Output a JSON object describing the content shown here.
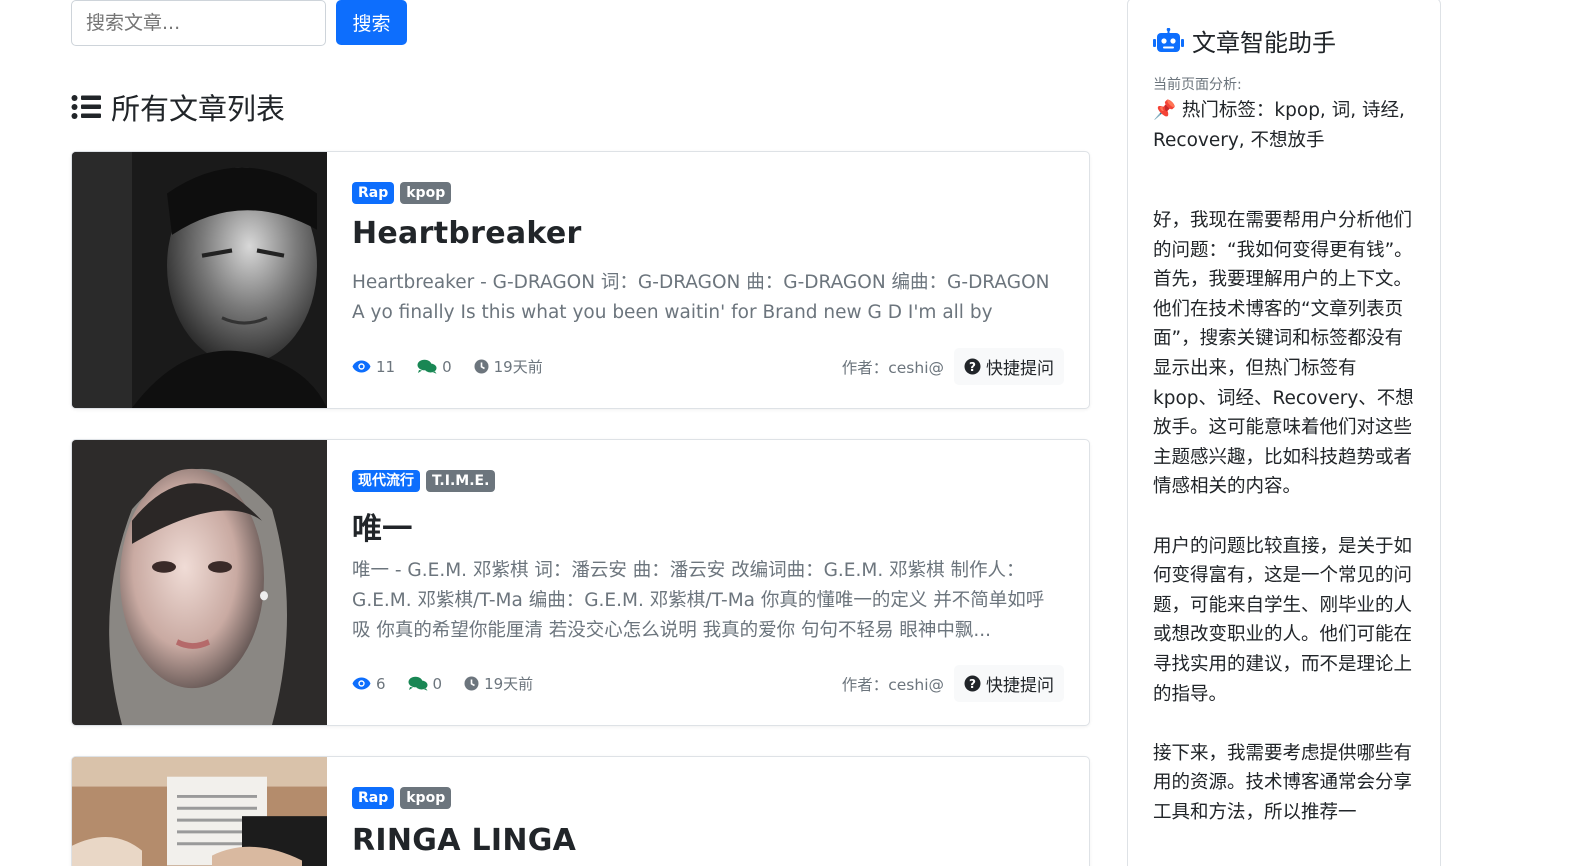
{
  "search": {
    "placeholder": "搜索文章...",
    "button_label": "搜索"
  },
  "list_heading": "所有文章列表",
  "articles": [
    {
      "tags": [
        {
          "label": "Rap",
          "style": "primary"
        },
        {
          "label": "kpop",
          "style": "secondary"
        }
      ],
      "title": "Heartbreaker",
      "excerpt": "Heartbreaker - G-DRAGON 词：G-DRAGON 曲：G-DRAGON 编曲：G-DRAGON A yo finally Is this what you been waitin' for Brand new G D I'm all by myself Bu...",
      "views": "11",
      "comments": "0",
      "time": "19天前",
      "author": "作者：ceshi@",
      "quick_ask": "快捷提问",
      "thumb": "monochrome portrait"
    },
    {
      "tags": [
        {
          "label": "现代流行",
          "style": "primary"
        },
        {
          "label": "T.I.M.E.",
          "style": "secondary"
        }
      ],
      "title": "唯一",
      "excerpt": "唯一 - G.E.M. 邓紫棋 词：潘云安 曲：潘云安 改编词曲：G.E.M. 邓紫棋 制作人：G.E.M. 邓紫棋/T-Ma 编曲：G.E.M. 邓紫棋/T-Ma 你真的懂唯一的定义 并不简单如呼吸 你真的希望你能厘清 若没交心怎么说明 我真的爱你 句句不轻易 眼神中飘...",
      "views": "6",
      "comments": "0",
      "time": "19天前",
      "author": "作者：ceshi@",
      "quick_ask": "快捷提问",
      "thumb": "portrait"
    },
    {
      "tags": [
        {
          "label": "Rap",
          "style": "primary"
        },
        {
          "label": "kpop",
          "style": "secondary"
        }
      ],
      "title": "RINGA LINGA",
      "thumb": "photo"
    }
  ],
  "assistant": {
    "title": "文章智能助手",
    "subtitle": "当前页面分析:",
    "hot_tags": "📌 热门标签：kpop, 词, 诗经, Recovery, 不想放手",
    "paragraphs": [
      "好，我现在需要帮用户分析他们的问题：“我如何变得更有钱”。首先，我要理解用户的上下文。他们在技术博客的“文章列表页面”，搜索关键词和标签都没有显示出来，但热门标签有kpop、词经、Recovery、不想放手。这可能意味着他们对这些主题感兴趣，比如科技趋势或者情感相关的内容。",
      "用户的问题比较直接，是关于如何变得富有，这是一个常见的问题，可能来自学生、刚毕业的人或想改变职业的人。他们可能在寻找实用的建议，而不是理论上的指导。",
      "接下来，我需要考虑提供哪些有用的资源。技术博客通常会分享工具和方法，所以推荐一"
    ]
  },
  "colors": {
    "primary": "#0d6efd",
    "secondary": "#6c757d",
    "text": "#212529",
    "muted": "#6c757d",
    "views_icon": "#0d6efd",
    "comments_icon": "#198754"
  }
}
